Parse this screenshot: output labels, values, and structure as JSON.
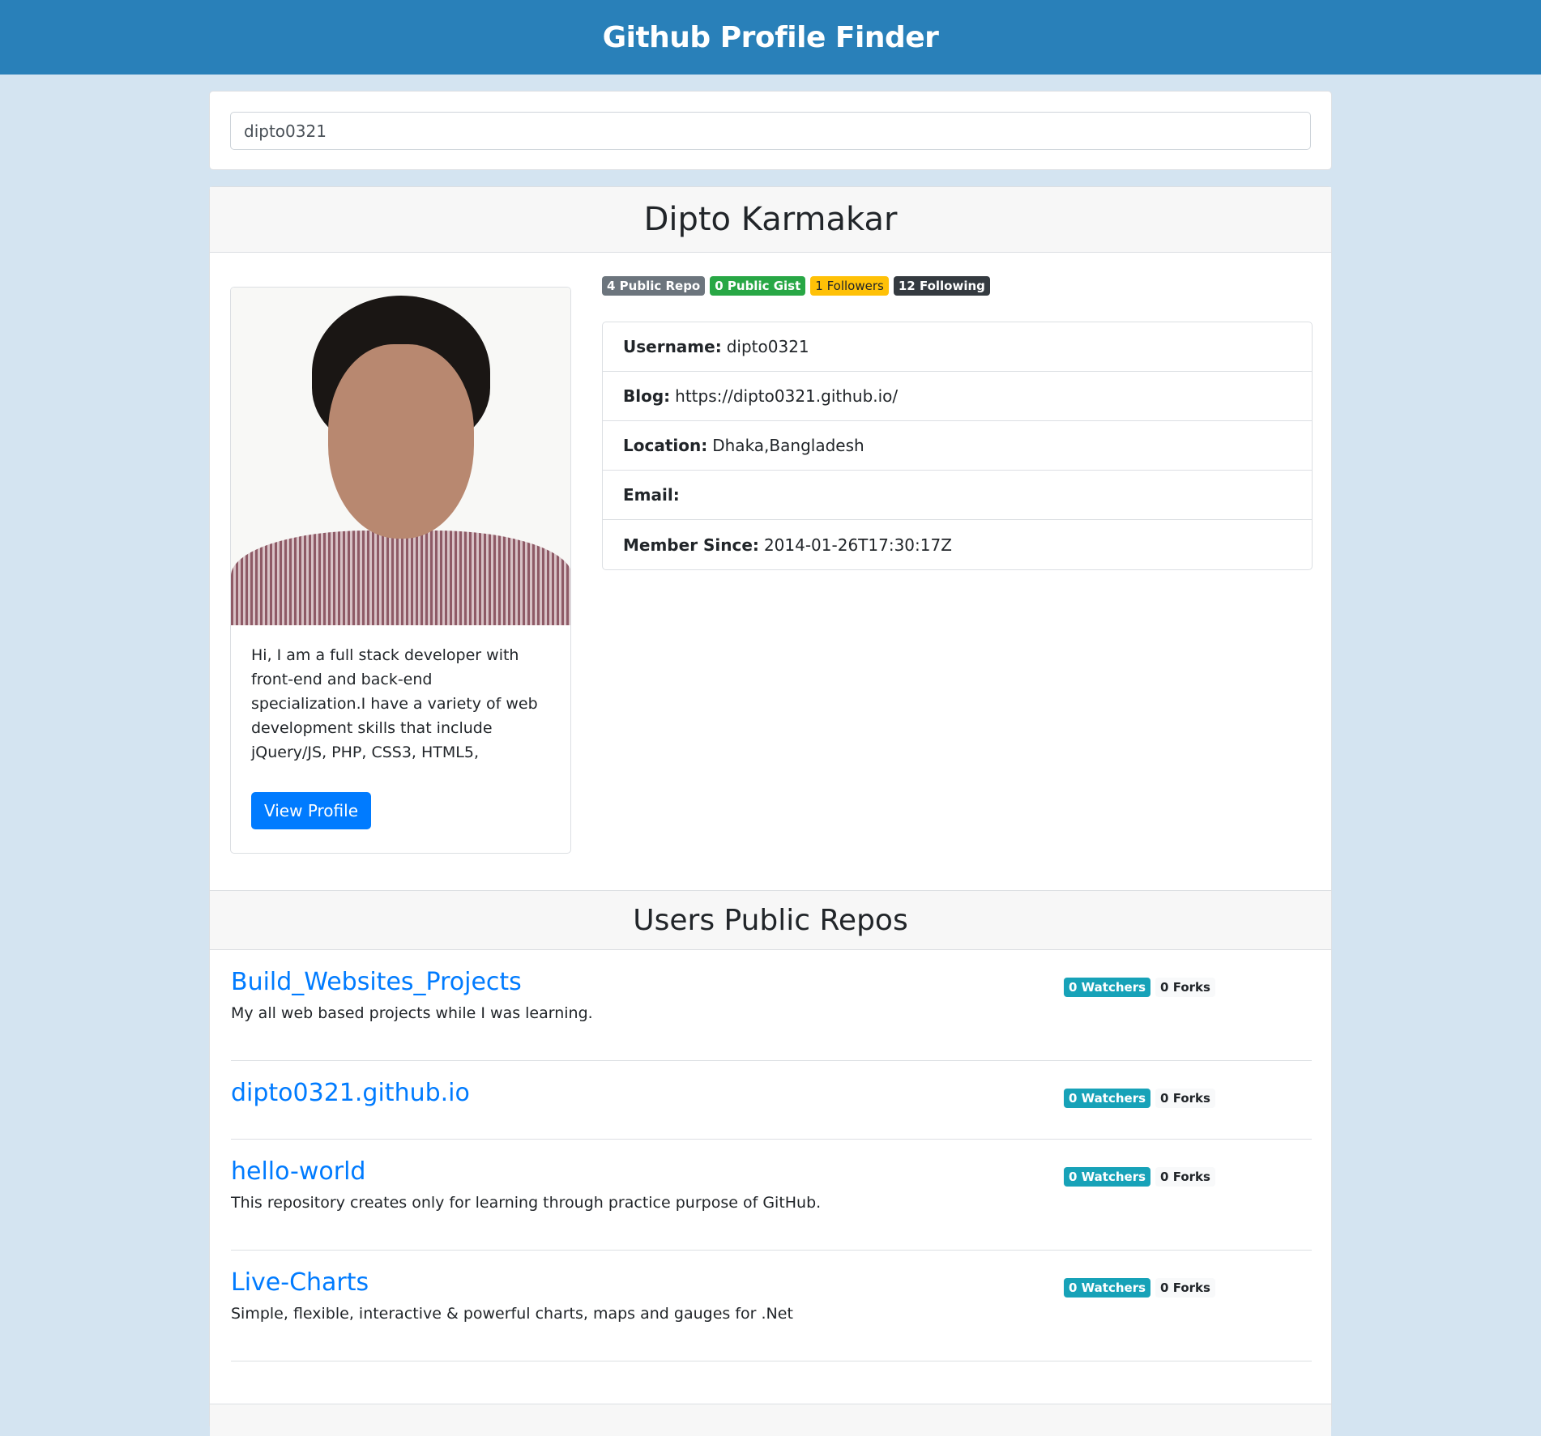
{
  "header": {
    "title": "Github Profile Finder"
  },
  "search": {
    "value": "dipto0321"
  },
  "profile": {
    "name": "Dipto Karmakar",
    "badges": [
      {
        "label": "4 Public Repo",
        "color": "#6c757d"
      },
      {
        "label": "0 Public Gist",
        "color": "#28a745"
      },
      {
        "label": "1 Followers",
        "color": "#ffc107"
      },
      {
        "label": "12 Following",
        "color": "#343a40"
      }
    ],
    "bio": "Hi, I am a full stack developer with front-end and back-end specialization.I have a variety of web development skills that include jQuery/JS, PHP, CSS3, HTML5,",
    "view_profile": "View Profile",
    "details": [
      {
        "label": "Username:",
        "value": "dipto0321"
      },
      {
        "label": "Blog:",
        "value": "https://dipto0321.github.io/"
      },
      {
        "label": "Location:",
        "value": "Dhaka,Bangladesh"
      },
      {
        "label": "Email:",
        "value": ""
      },
      {
        "label": "Member Since:",
        "value": "2014-01-26T17:30:17Z"
      }
    ]
  },
  "repos": {
    "title": "Users Public Repos",
    "items": [
      {
        "name": "Build_Websites_Projects",
        "description": "My all web based projects while I was learning.",
        "watchers": "0 Watchers",
        "forks": "0 Forks"
      },
      {
        "name": "dipto0321.github.io",
        "description": "",
        "watchers": "0 Watchers",
        "forks": "0 Forks"
      },
      {
        "name": "hello-world",
        "description": "This repository creates only for learning through practice purpose of GitHub.",
        "watchers": "0 Watchers",
        "forks": "0 Forks"
      },
      {
        "name": "Live-Charts",
        "description": "Simple, flexible, interactive & powerful charts, maps and gauges for .Net",
        "watchers": "0 Watchers",
        "forks": "0 Forks"
      }
    ]
  }
}
